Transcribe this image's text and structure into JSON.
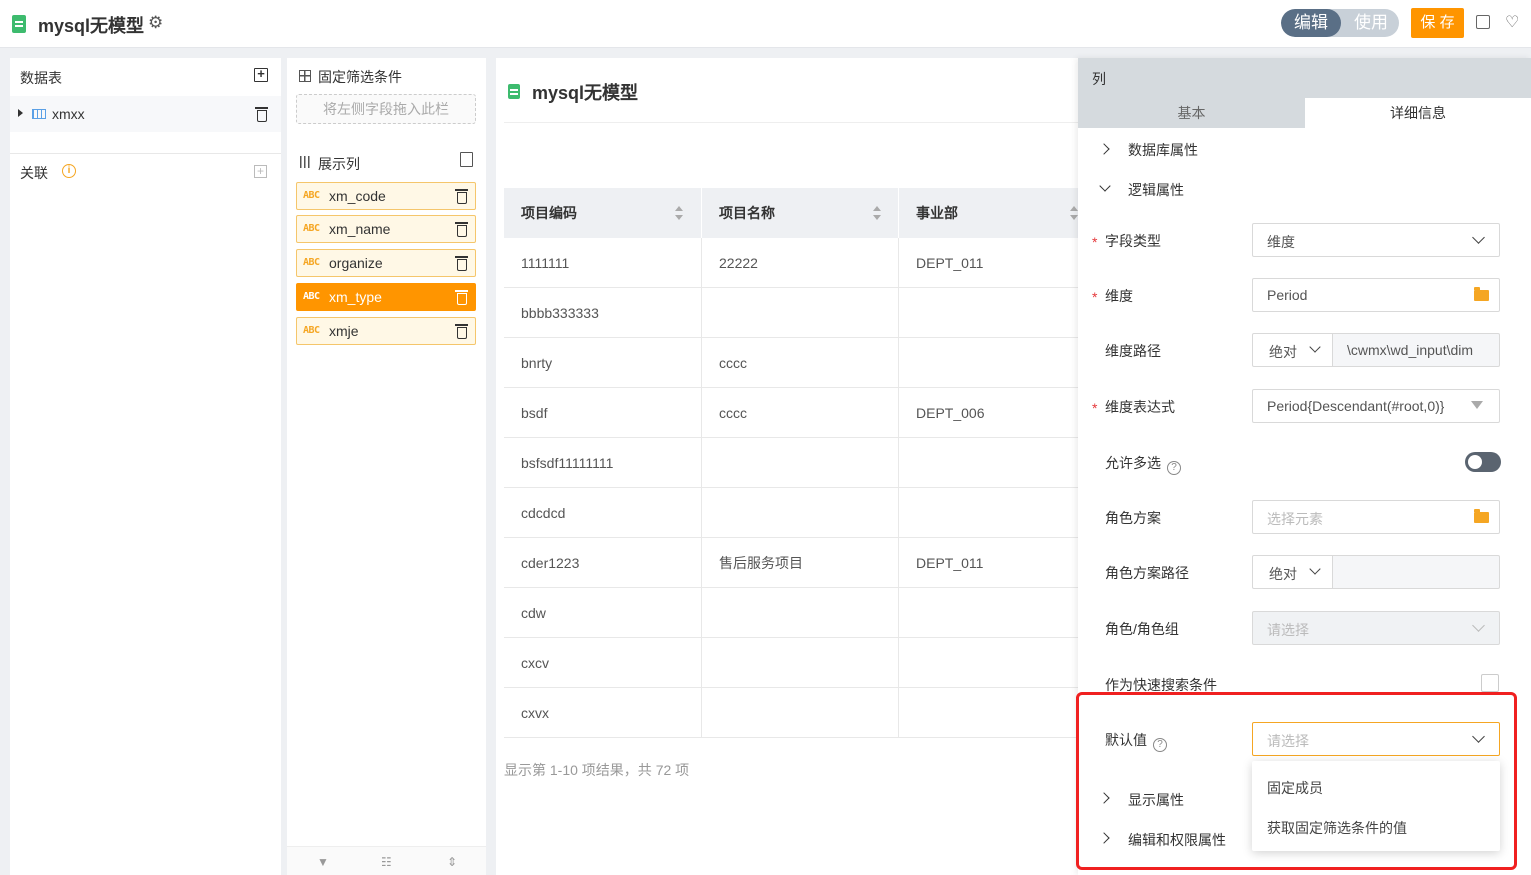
{
  "app": {
    "title": "mysql无模型"
  },
  "topbar": {
    "mode_edit": "编辑",
    "mode_use": "使用",
    "save": "保 存"
  },
  "left": {
    "header": "数据表",
    "table_name": "xmxx",
    "relation": "关联",
    "relation_info": "i"
  },
  "middle": {
    "filter_title": "固定筛选条件",
    "drop_placeholder": "将左侧字段拖入此栏",
    "columns_title": "展示列",
    "fields": [
      {
        "type": "ABC",
        "name": "xm_code"
      },
      {
        "type": "ABC",
        "name": "xm_name"
      },
      {
        "type": "ABC",
        "name": "organize"
      },
      {
        "type": "ABC",
        "name": "xm_type"
      },
      {
        "type": "ABC",
        "name": "xmje"
      }
    ]
  },
  "main": {
    "title": "mysql无模型",
    "columns": [
      "项目编码",
      "项目名称",
      "事业部"
    ],
    "rows": [
      [
        "1111111",
        "22222",
        "DEPT_011"
      ],
      [
        "bbbb333333",
        "",
        ""
      ],
      [
        "bnrty",
        "cccc",
        ""
      ],
      [
        "bsdf",
        "cccc",
        "DEPT_006"
      ],
      [
        "bsfsdf11111111",
        "",
        ""
      ],
      [
        "cdcdcd",
        "",
        ""
      ],
      [
        "cder1223",
        "售后服务项目",
        "DEPT_011"
      ],
      [
        "cdw",
        "",
        ""
      ],
      [
        "cxcv",
        "",
        ""
      ],
      [
        "cxvx",
        "",
        ""
      ]
    ],
    "result_text": "显示第 1-10 项结果，共 72 项"
  },
  "right": {
    "title": "列",
    "tab_basic": "基本",
    "tab_detail": "详细信息",
    "sec_db": "数据库属性",
    "sec_logic": "逻辑属性",
    "required_mark": "*",
    "field_type_label": "字段类型",
    "field_type_value": "维度",
    "dimension_label": "维度",
    "dimension_value": "Period",
    "dim_path_label": "维度路径",
    "dim_path_mode": "绝对",
    "dim_path_value": "\\cwmx\\wd_input\\dim",
    "dim_expr_label": "维度表达式",
    "dim_expr_value": "Period{Descendant(#root,0)}",
    "multi_label": "允许多选",
    "role_scheme_label": "角色方案",
    "role_scheme_placeholder": "选择元素",
    "role_path_label": "角色方案路径",
    "role_path_mode": "绝对",
    "role_group_label": "角色/角色组",
    "role_group_placeholder": "请选择",
    "quick_search_label": "作为快速搜索条件",
    "default_label": "默认值",
    "default_placeholder": "请选择",
    "qmark": "?",
    "sec_display": "显示属性",
    "sec_edit": "编辑和权限属性",
    "dropdown_options": [
      "固定成员",
      "获取固定筛选条件的值"
    ]
  }
}
